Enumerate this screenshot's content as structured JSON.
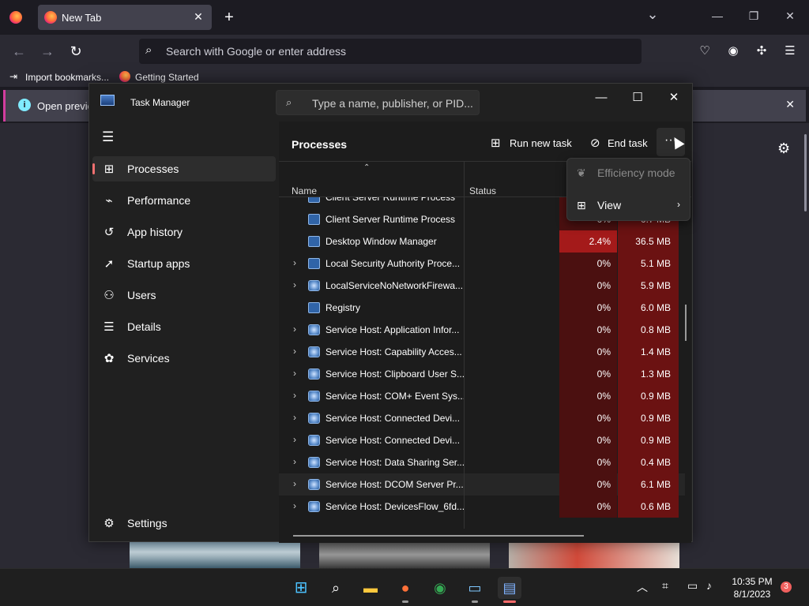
{
  "browser": {
    "tab_title": "New Tab",
    "tab_close": "✕",
    "new_tab": "+",
    "list_tabs": "⌄",
    "win_min": "—",
    "win_restore": "❐",
    "win_close": "✕",
    "back": "←",
    "forward": "→",
    "reload": "↻",
    "url_placeholder": "Search with Google or enter address",
    "bookmark_import": "Import bookmarks...",
    "bookmark_getting_started": "Getting Started",
    "info_text": "Open previo",
    "info_close": "✕",
    "settings_icon": "⚙"
  },
  "task_manager": {
    "title": "Task Manager",
    "search_placeholder": "Type a name, publisher, or PID...",
    "controls": {
      "min": "—",
      "max": "☐",
      "close": "✕"
    },
    "sidebar": {
      "items": [
        {
          "label": "Processes",
          "icon": "processes-icon",
          "glyph": "⊞",
          "active": true
        },
        {
          "label": "Performance",
          "icon": "performance-icon",
          "glyph": "⌁",
          "active": false
        },
        {
          "label": "App history",
          "icon": "history-icon",
          "glyph": "↺",
          "active": false
        },
        {
          "label": "Startup apps",
          "icon": "startup-icon",
          "glyph": "➚",
          "active": false
        },
        {
          "label": "Users",
          "icon": "users-icon",
          "glyph": "⚇",
          "active": false
        },
        {
          "label": "Details",
          "icon": "details-icon",
          "glyph": "☰",
          "active": false
        },
        {
          "label": "Services",
          "icon": "services-icon",
          "glyph": "✿",
          "active": false
        }
      ],
      "settings_label": "Settings"
    },
    "header": "Processes",
    "toolbar": {
      "run_new_task": "Run new task",
      "end_task": "End task",
      "more": "···"
    },
    "columns": {
      "name": "Name",
      "status": "Status"
    },
    "menu": {
      "efficiency_mode": "Efficiency mode",
      "view": "View"
    },
    "rows": [
      {
        "name": "Client Server Runtime Process",
        "expand": false,
        "type": "app",
        "cpu": "",
        "mem": ""
      },
      {
        "name": "Client Server Runtime Process",
        "expand": false,
        "type": "app",
        "cpu": "0%",
        "mem": "0.7 MB"
      },
      {
        "name": "Desktop Window Manager",
        "expand": false,
        "type": "app",
        "cpu": "2.4%",
        "mem": "36.5 MB",
        "hot": true
      },
      {
        "name": "Local Security Authority Proce...",
        "expand": true,
        "type": "app",
        "cpu": "0%",
        "mem": "5.1 MB"
      },
      {
        "name": "LocalServiceNoNetworkFirewa...",
        "expand": true,
        "type": "svc",
        "cpu": "0%",
        "mem": "5.9 MB"
      },
      {
        "name": "Registry",
        "expand": false,
        "type": "app",
        "cpu": "0%",
        "mem": "6.0 MB"
      },
      {
        "name": "Service Host: Application Infor...",
        "expand": true,
        "type": "svc",
        "cpu": "0%",
        "mem": "0.8 MB"
      },
      {
        "name": "Service Host: Capability Acces...",
        "expand": true,
        "type": "svc",
        "cpu": "0%",
        "mem": "1.4 MB"
      },
      {
        "name": "Service Host: Clipboard User S...",
        "expand": true,
        "type": "svc",
        "cpu": "0%",
        "mem": "1.3 MB"
      },
      {
        "name": "Service Host: COM+ Event Sys...",
        "expand": true,
        "type": "svc",
        "cpu": "0%",
        "mem": "0.9 MB"
      },
      {
        "name": "Service Host: Connected Devi...",
        "expand": true,
        "type": "svc",
        "cpu": "0%",
        "mem": "0.9 MB"
      },
      {
        "name": "Service Host: Connected Devi...",
        "expand": true,
        "type": "svc",
        "cpu": "0%",
        "mem": "0.9 MB"
      },
      {
        "name": "Service Host: Data Sharing Ser...",
        "expand": true,
        "type": "svc",
        "cpu": "0%",
        "mem": "0.4 MB"
      },
      {
        "name": "Service Host: DCOM Server Pr...",
        "expand": true,
        "type": "svc",
        "cpu": "0%",
        "mem": "6.1 MB",
        "highlight": true
      },
      {
        "name": "Service Host: DevicesFlow_6fd...",
        "expand": true,
        "type": "svc",
        "cpu": "0%",
        "mem": "0.6 MB"
      }
    ]
  },
  "taskbar": {
    "time": "10:35 PM",
    "date": "8/1/2023",
    "notification_count": "3",
    "tray_chevron": "︿"
  }
}
